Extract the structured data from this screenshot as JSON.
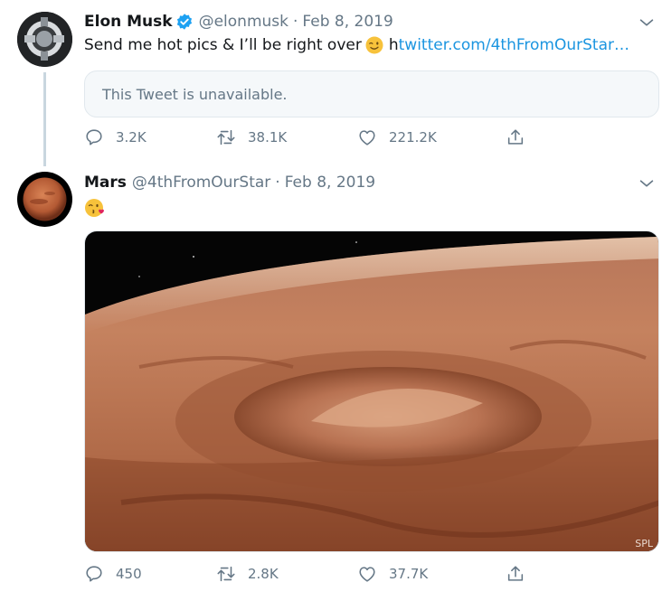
{
  "tweet1": {
    "author_name": "Elon Musk",
    "author_handle": "@elonmusk",
    "separator": "·",
    "date": "Feb 8, 2019",
    "text": "Send me hot pics & I’ll be right over",
    "text_emoji": "winking-face",
    "link_prefix": "h",
    "link_text": "twitter.com/4thFromOurStar…",
    "quote_text": "This Tweet is unavailable.",
    "replies": "3.2K",
    "retweets": "38.1K",
    "likes": "221.2K"
  },
  "tweet2": {
    "author_name": "Mars",
    "author_handle": "@4thFromOurStar",
    "separator": "·",
    "date": "Feb 8, 2019",
    "text_emoji": "face-blowing-a-kiss",
    "media_credit": "SPL",
    "replies": "450",
    "retweets": "2.8K",
    "likes": "37.7K"
  },
  "colors": {
    "secondary_text": "#657786",
    "link": "#1b95e0",
    "verified": "#1da1f2",
    "border": "#e1e8ed",
    "quote_background": "#f5f8fa"
  }
}
